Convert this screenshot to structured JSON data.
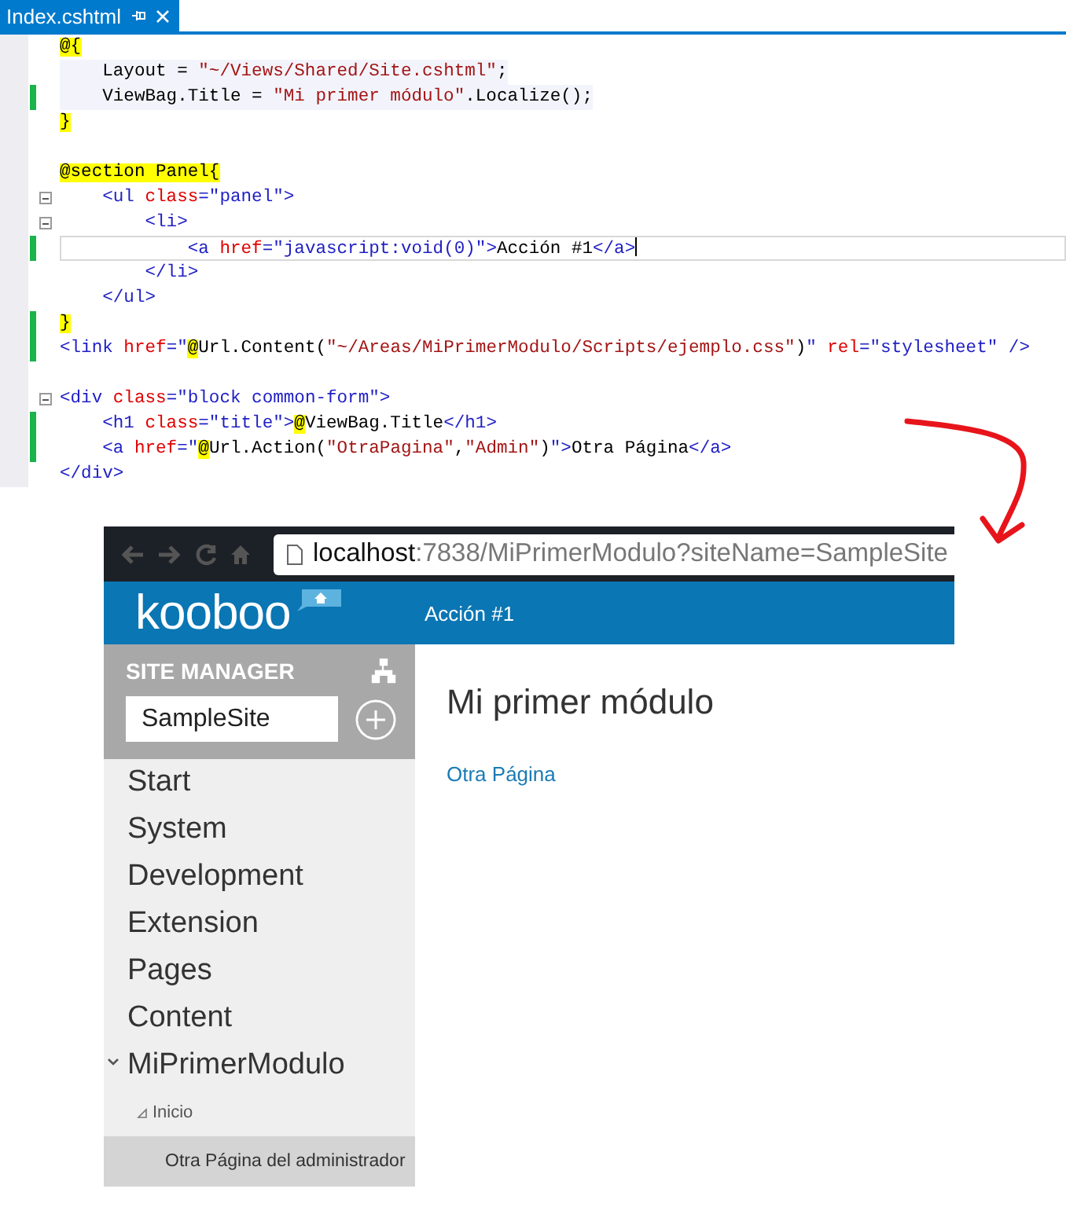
{
  "editor": {
    "tab": {
      "title": "Index.cshtml",
      "selected": true
    },
    "lines": [
      {
        "changed": false,
        "fold": false,
        "code_block": false,
        "current": false,
        "tokens": [
          {
            "t": "@{",
            "kind": "razor"
          }
        ]
      },
      {
        "changed": false,
        "fold": false,
        "code_block": true,
        "current": false,
        "tokens": [
          {
            "t": "    Layout = ",
            "kind": "text"
          },
          {
            "t": "\"~/Views/Shared/Site.cshtml\"",
            "kind": "string"
          },
          {
            "t": ";",
            "kind": "text"
          }
        ]
      },
      {
        "changed": true,
        "fold": false,
        "code_block": true,
        "current": false,
        "tokens": [
          {
            "t": "    ViewBag.Title = ",
            "kind": "text"
          },
          {
            "t": "\"Mi primer módulo\"",
            "kind": "string"
          },
          {
            "t": ".Localize();",
            "kind": "text"
          }
        ]
      },
      {
        "changed": false,
        "fold": false,
        "code_block": false,
        "current": false,
        "tokens": [
          {
            "t": "}",
            "kind": "razor"
          }
        ]
      },
      {
        "changed": false,
        "fold": false,
        "code_block": false,
        "current": false
      },
      {
        "changed": false,
        "fold": false,
        "code_block": false,
        "current": false,
        "tokens": [
          {
            "t": "@section Panel{",
            "kind": "razor"
          }
        ]
      },
      {
        "changed": false,
        "fold": true,
        "code_block": false,
        "current": false,
        "tokens": [
          {
            "t": "    <ul",
            "kind": "tag"
          },
          {
            "t": " class",
            "kind": "attr"
          },
          {
            "t": "=\"panel\">",
            "kind": "tag"
          }
        ]
      },
      {
        "changed": false,
        "fold": true,
        "code_block": false,
        "current": false,
        "tokens": [
          {
            "t": "        <li>",
            "kind": "tag"
          }
        ]
      },
      {
        "changed": true,
        "fold": false,
        "code_block": false,
        "current": true,
        "tokens": [
          {
            "t": "            <a",
            "kind": "tag"
          },
          {
            "t": " href",
            "kind": "attr"
          },
          {
            "t": "=\"javascript:void(0)\">",
            "kind": "tag"
          },
          {
            "t": "Acción #1",
            "kind": "text"
          },
          {
            "t": "</a>",
            "kind": "tag"
          }
        ]
      },
      {
        "changed": false,
        "fold": false,
        "code_block": false,
        "current": false,
        "tokens": [
          {
            "t": "        </li>",
            "kind": "tag"
          }
        ]
      },
      {
        "changed": false,
        "fold": false,
        "code_block": false,
        "current": false,
        "tokens": [
          {
            "t": "    </ul>",
            "kind": "tag"
          }
        ]
      },
      {
        "changed": true,
        "fold": false,
        "code_block": false,
        "current": false,
        "tokens": [
          {
            "t": "}",
            "kind": "razor"
          }
        ]
      },
      {
        "changed": true,
        "fold": false,
        "code_block": false,
        "current": false,
        "tokens": [
          {
            "t": "<link",
            "kind": "tag"
          },
          {
            "t": " href",
            "kind": "attr"
          },
          {
            "t": "=\"",
            "kind": "tag"
          },
          {
            "t": "@",
            "kind": "razor"
          },
          {
            "t": "Url.Content(",
            "kind": "text"
          },
          {
            "t": "\"~/Areas/MiPrimerModulo/Scripts/ejemplo.css\"",
            "kind": "string"
          },
          {
            "t": ")",
            "kind": "text"
          },
          {
            "t": "\"",
            "kind": "tag"
          },
          {
            "t": " rel",
            "kind": "attr"
          },
          {
            "t": "=\"stylesheet\" />",
            "kind": "tag"
          }
        ]
      },
      {
        "changed": false,
        "fold": false,
        "code_block": false,
        "current": false
      },
      {
        "changed": false,
        "fold": true,
        "code_block": false,
        "current": false,
        "tokens": [
          {
            "t": "<div",
            "kind": "tag"
          },
          {
            "t": " class",
            "kind": "attr"
          },
          {
            "t": "=\"block common-form\">",
            "kind": "tag"
          }
        ]
      },
      {
        "changed": true,
        "fold": false,
        "code_block": false,
        "current": false,
        "tokens": [
          {
            "t": "    <h1",
            "kind": "tag"
          },
          {
            "t": " class",
            "kind": "attr"
          },
          {
            "t": "=\"title\">",
            "kind": "tag"
          },
          {
            "t": "@",
            "kind": "razor"
          },
          {
            "t": "ViewBag.Title",
            "kind": "text"
          },
          {
            "t": "</h1>",
            "kind": "tag"
          }
        ]
      },
      {
        "changed": true,
        "fold": false,
        "code_block": false,
        "current": false,
        "tokens": [
          {
            "t": "    <a",
            "kind": "tag"
          },
          {
            "t": " href",
            "kind": "attr"
          },
          {
            "t": "=\"",
            "kind": "tag"
          },
          {
            "t": "@",
            "kind": "razor"
          },
          {
            "t": "Url.Action(",
            "kind": "text"
          },
          {
            "t": "\"OtraPagina\"",
            "kind": "string"
          },
          {
            "t": ",",
            "kind": "text"
          },
          {
            "t": "\"Admin\"",
            "kind": "string"
          },
          {
            "t": ")",
            "kind": "text"
          },
          {
            "t": "\">",
            "kind": "tag"
          },
          {
            "t": "Otra Página",
            "kind": "text"
          },
          {
            "t": "</a>",
            "kind": "tag"
          }
        ]
      },
      {
        "changed": false,
        "fold": false,
        "code_block": false,
        "current": false,
        "tokens": [
          {
            "t": "</div>",
            "kind": "tag"
          }
        ]
      }
    ]
  },
  "browser": {
    "url_host": "localhost",
    "url_rest": ":7838/MiPrimerModulo?siteName=SampleSite",
    "header": {
      "logo": "kooboo",
      "link": "Acción #1"
    },
    "sidebar": {
      "heading": "SITE MANAGER",
      "site_field": {
        "value": "SampleSite"
      },
      "items": [
        {
          "label": "Start",
          "selected": false,
          "expanded": false
        },
        {
          "label": "System",
          "selected": false,
          "expanded": false
        },
        {
          "label": "Development",
          "selected": false,
          "expanded": false
        },
        {
          "label": "Extension",
          "selected": false,
          "expanded": false
        },
        {
          "label": "Pages",
          "selected": false,
          "expanded": false
        },
        {
          "label": "Content",
          "selected": false,
          "expanded": false
        },
        {
          "label": "MiPrimerModulo",
          "selected": false,
          "expanded": true,
          "children": [
            {
              "label": "Inicio",
              "selected": false,
              "expanded": true,
              "children": [
                {
                  "label": "Otra Página del administrador",
                  "selected": true
                }
              ]
            }
          ]
        }
      ]
    },
    "page": {
      "title": "Mi primer módulo",
      "link": "Otra Página"
    }
  }
}
